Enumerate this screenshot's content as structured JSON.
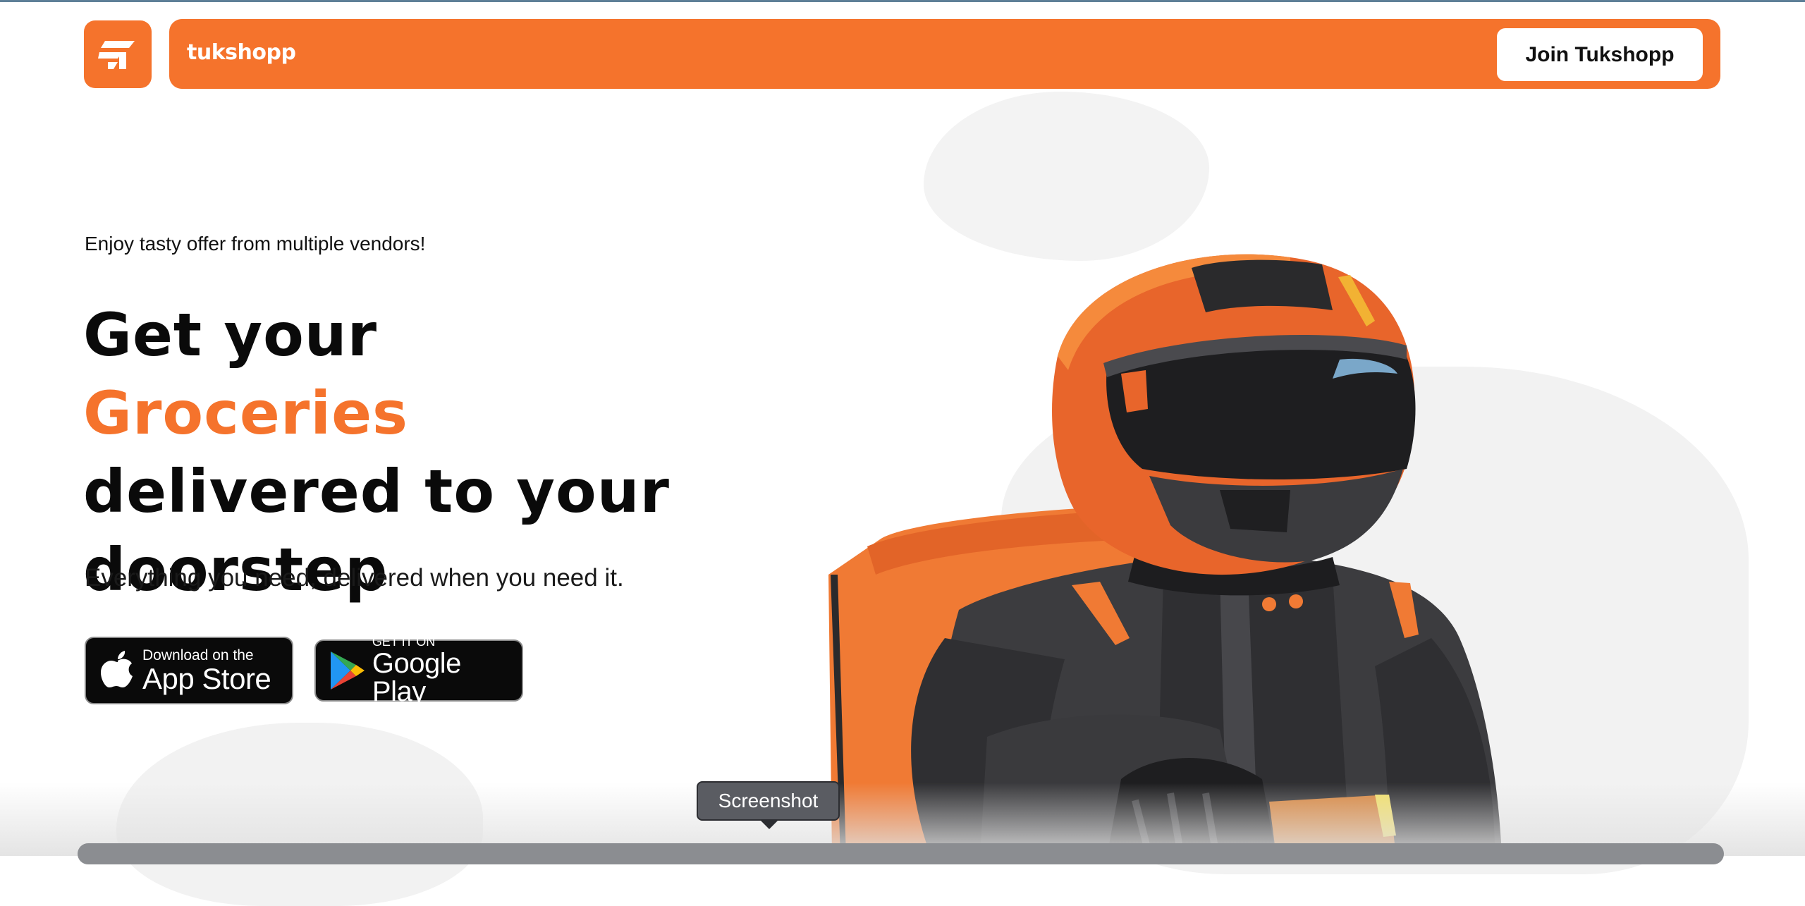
{
  "header": {
    "brand_name": "tukshopp",
    "join_button_label": "Join Tukshopp",
    "accent_color": "#f5732c"
  },
  "hero": {
    "eyebrow": "Enjoy tasty offer from multiple vendors!",
    "headline_prefix": "Get your",
    "headline_accent": "Groceries",
    "headline_line2": "delivered to your",
    "headline_line3": "doorstep",
    "subheading": "Everything you need, delivered when you need it."
  },
  "store_buttons": {
    "app_store": {
      "small_text": "Download on the",
      "big_text": "App Store",
      "icon": "apple-icon"
    },
    "google_play": {
      "small_text": "GET IT ON",
      "big_text": "Google Play",
      "icon": "google-play-icon"
    }
  },
  "tooltip": {
    "label": "Screenshot"
  }
}
